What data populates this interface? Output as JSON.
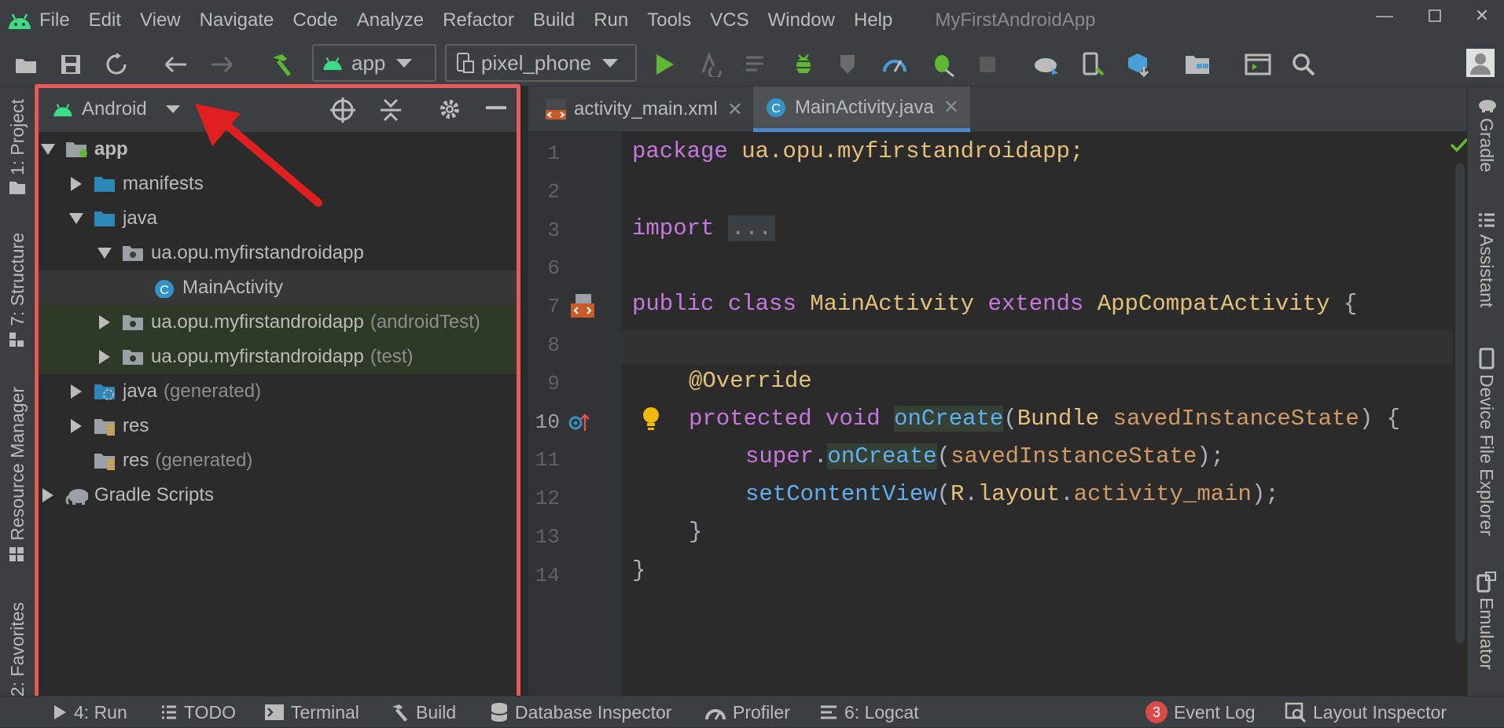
{
  "window": {
    "title": "MyFirstAndroidApp",
    "menu": [
      "File",
      "Edit",
      "View",
      "Navigate",
      "Code",
      "Analyze",
      "Refactor",
      "Build",
      "Run",
      "Tools",
      "VCS",
      "Window",
      "Help"
    ]
  },
  "toolbar": {
    "run_config": "app",
    "device": "pixel_phone"
  },
  "left_tool_strip": {
    "project": "1: Project",
    "structure": "7: Structure",
    "resource_manager": "Resource Manager",
    "favorites": "2: Favorites"
  },
  "right_tool_strip": {
    "gradle": "Gradle",
    "assistant": "Assistant",
    "device_file_explorer": "Device File Explorer",
    "emulator": "Emulator"
  },
  "project_panel": {
    "view_mode": "Android",
    "tree": [
      {
        "label": "app",
        "suffix": ""
      },
      {
        "label": "manifests",
        "suffix": ""
      },
      {
        "label": "java",
        "suffix": ""
      },
      {
        "label": "ua.opu.myfirstandroidapp",
        "suffix": ""
      },
      {
        "label": "MainActivity",
        "suffix": ""
      },
      {
        "label": "ua.opu.myfirstandroidapp",
        "suffix": "(androidTest)"
      },
      {
        "label": "ua.opu.myfirstandroidapp",
        "suffix": "(test)"
      },
      {
        "label": "java",
        "suffix": "(generated)"
      },
      {
        "label": "res",
        "suffix": ""
      },
      {
        "label": "res",
        "suffix": "(generated)"
      },
      {
        "label": "Gradle Scripts",
        "suffix": ""
      }
    ]
  },
  "editor": {
    "tabs": [
      {
        "label": "activity_main.xml",
        "active": false
      },
      {
        "label": "MainActivity.java",
        "active": true
      }
    ],
    "line_numbers": [
      "1",
      "2",
      "3",
      "6",
      "7",
      "8",
      "9",
      "10",
      "11",
      "12",
      "13",
      "14"
    ],
    "code": {
      "l1_kw": "package",
      "l1_rest": " ua.opu.myfirstandroidapp;",
      "l3_kw": "import",
      "l3_fold": "...",
      "l7_public": "public",
      "l7_class": "class",
      "l7_name": "MainActivity",
      "l7_extends": "extends",
      "l7_parent": "AppCompatActivity",
      "l7_brace": " {",
      "l9_annotation": "@Override",
      "l10_protected": "protected",
      "l10_void": "void",
      "l10_method": "onCreate",
      "l10_type": "Bundle",
      "l10_param": "savedInstanceState",
      "l10_end": ") {",
      "l11_super": "super",
      "l11_method": "onCreate",
      "l11_arg": "savedInstanceState",
      "l11_end": ");",
      "l12_method": "setContentView",
      "l12_r": "R",
      "l12_layout": "layout",
      "l12_field": "activity_main",
      "l12_end": ");",
      "l13": "}",
      "l14": "}"
    }
  },
  "status_bar": {
    "run": "4: Run",
    "todo": "TODO",
    "terminal": "Terminal",
    "build": "Build",
    "database_inspector": "Database Inspector",
    "profiler": "Profiler",
    "logcat": "6: Logcat",
    "event_log_count": "3",
    "event_log": "Event Log",
    "layout_inspector": "Layout Inspector"
  },
  "colors": {
    "highlight": "#e8595a",
    "arrow": "#e02020",
    "android_green": "#3ddc84",
    "accent_blue": "#4a88c7"
  }
}
